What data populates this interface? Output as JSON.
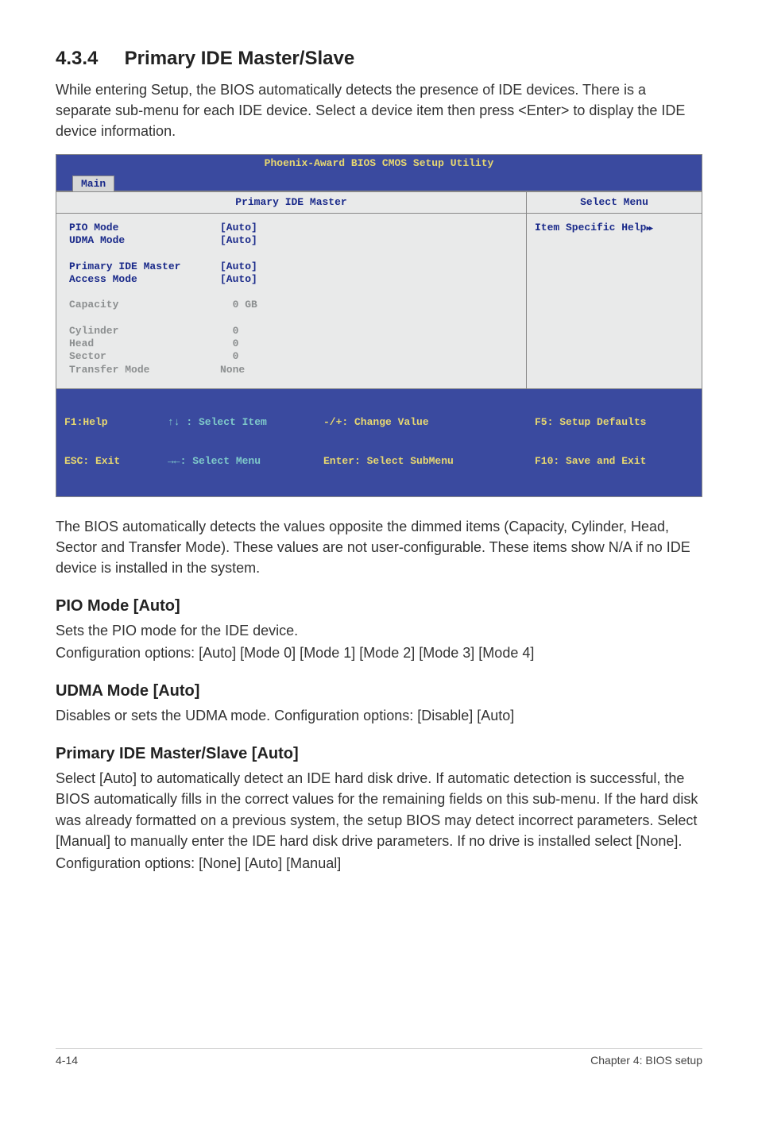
{
  "heading_num": "4.3.4",
  "heading_text": "Primary IDE Master/Slave",
  "intro_text": "While entering Setup, the BIOS automatically detects the presence of IDE devices. There is a separate sub-menu for each IDE device. Select a device item then press <Enter> to display the IDE device information.",
  "bios": {
    "title": "Phoenix-Award BIOS CMOS Setup Utility",
    "tab": "Main",
    "panel_title_left": "Primary IDE Master",
    "panel_title_right": "Select Menu",
    "help_text": "Item Specific Help",
    "rows": {
      "pio_label": "PIO Mode",
      "pio_value": "[Auto]",
      "udma_label": "UDMA Mode",
      "udma_value": "[Auto]",
      "pim_label": "Primary IDE Master",
      "pim_value": "[Auto]",
      "access_label": "Access Mode",
      "access_value": "[Auto]",
      "capacity_label": "Capacity",
      "capacity_value": "  0 GB",
      "cylinder_label": "Cylinder",
      "cylinder_value": "  0",
      "head_label": "Head",
      "head_value": "  0",
      "sector_label": "Sector",
      "sector_value": "  0",
      "transfer_label": "Transfer Mode",
      "transfer_value": "None"
    },
    "footer": {
      "f1": "F1:Help",
      "esc": "ESC: Exit",
      "select_item": "↑↓ : Select Item",
      "select_menu": "→←: Select Menu",
      "change_value": "-/+: Change Value",
      "select_sub": "Enter: Select SubMenu",
      "setup_defaults": "F5: Setup Defaults",
      "save_exit": "F10: Save and Exit"
    }
  },
  "para_after_bios": "The BIOS automatically detects the values opposite the dimmed items (Capacity, Cylinder,  Head, Sector and Transfer Mode). These values are not user-configurable. These items show N/A if no IDE device is installed in the system.",
  "pio": {
    "heading": "PIO Mode [Auto]",
    "line1": "Sets the PIO mode for the IDE device.",
    "line2": "Configuration options: [Auto] [Mode 0] [Mode 1] [Mode 2] [Mode 3] [Mode 4]"
  },
  "udma": {
    "heading": "UDMA Mode [Auto]",
    "line1": "Disables or sets the UDMA mode. Configuration options: [Disable] [Auto]"
  },
  "pim": {
    "heading": "Primary IDE Master/Slave [Auto]",
    "line1": "Select [Auto] to automatically detect an IDE hard disk drive. If automatic detection is successful, the BIOS automatically fills in the correct values for the remaining fields on this sub-menu. If the hard disk was already formatted on a previous system, the setup BIOS may detect incorrect parameters. Select [Manual] to manually enter the IDE hard disk drive parameters. If no drive is installed select [None].",
    "line2": "Configuration options: [None] [Auto] [Manual]"
  },
  "footer_left": "4-14",
  "footer_right": "Chapter 4: BIOS setup"
}
